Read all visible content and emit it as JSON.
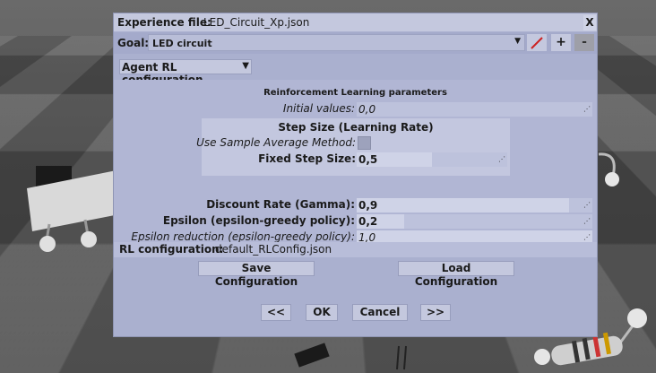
{
  "dialog": {
    "title_label": "Experience file:",
    "title_value": "LED_Circuit_Xp.json",
    "close_label": "X"
  },
  "goal": {
    "label": "Goal:",
    "selected": "LED circuit",
    "add_label": "+",
    "remove_label": "-"
  },
  "section": {
    "label": "Agent RL configuration"
  },
  "params": {
    "title": "Reinforcement Learning parameters",
    "initial_values": {
      "label": "Initial values:",
      "value": "0,0"
    },
    "step_size": {
      "title": "Step Size (Learning Rate)",
      "sample_average_label": "Use Sample Average Method:",
      "fixed_label": "Fixed Step Size:",
      "fixed_value": "0,5",
      "fixed_fill": 0.5
    },
    "discount": {
      "label": "Discount Rate (Gamma):",
      "value": "0,9",
      "fill": 0.9
    },
    "epsilon": {
      "label": "Epsilon (epsilon-greedy policy):",
      "value": "0,2",
      "fill": 0.2
    },
    "epsilon_reduction": {
      "label": "Epsilon reduction (epsilon-greedy policy):",
      "value": "1,0",
      "fill": 1.0
    }
  },
  "rl_config": {
    "label": "RL configuration:",
    "value": "default_RLConfig.json",
    "save_label": "Save Configuration",
    "load_label": "Load Configuration"
  },
  "footer": {
    "prev_label": "<<",
    "ok_label": "OK",
    "cancel_label": "Cancel",
    "next_label": ">>"
  },
  "colors": {
    "dialog_bg": "#aab0cf",
    "edit_icon": "#cc2222"
  }
}
